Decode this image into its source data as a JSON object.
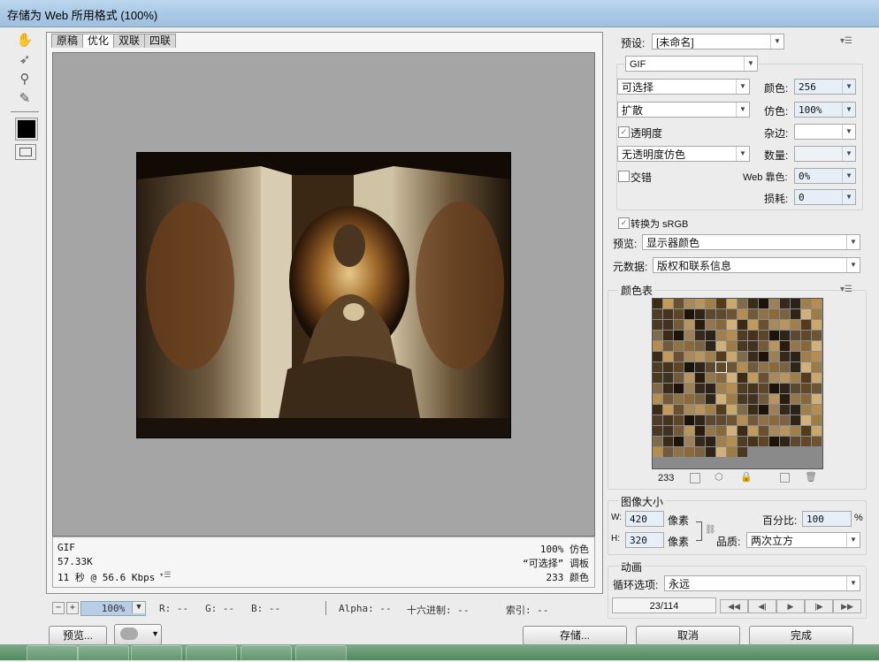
{
  "window": {
    "title": "存储为 Web 所用格式 (100%)"
  },
  "tabs": [
    "原稿",
    "优化",
    "双联",
    "四联"
  ],
  "info": {
    "left": [
      "GIF",
      "57.33K",
      "11 秒 @ 56.6 Kbps"
    ],
    "right": [
      "100% 仿色",
      "“可选择” 调板",
      "233 颜色"
    ]
  },
  "statusbar": {
    "zoom": "100%",
    "r": "R: --",
    "g": "G: --",
    "b": "B: --",
    "alpha": "Alpha: --",
    "hex": "十六进制: --",
    "index": "索引: --"
  },
  "buttons": {
    "preview": "预览...",
    "save": "存储...",
    "cancel": "取消",
    "done": "完成"
  },
  "settings": {
    "preset_label": "预设:",
    "preset_value": "[未命名]",
    "format": "GIF",
    "reduction": "可选择",
    "dither_algo": "扩散",
    "colors_label": "颜色:",
    "colors_value": "256",
    "dither_label": "仿色:",
    "dither_value": "100%",
    "transparency_label": "透明度",
    "transparency_checked": true,
    "matte_label": "杂边:",
    "trans_dither": "无透明度仿色",
    "amount_label": "数量:",
    "interlace_label": "交错",
    "interlace_checked": false,
    "websnap_label": "Web 靠色:",
    "websnap_value": "0%",
    "lossy_label": "损耗:",
    "lossy_value": "0",
    "srgb_label": "转换为 sRGB",
    "srgb_checked": true,
    "preview_label": "预览:",
    "preview_value": "显示器颜色",
    "metadata_label": "元数据:",
    "metadata_value": "版权和联系信息"
  },
  "color_table": {
    "title": "颜色表",
    "count": "233",
    "colors": [
      "#3b2a15",
      "#5e4525",
      "#8a6a3a",
      "#2a1c0c",
      "#a17f4b",
      "#6b5533",
      "#4a3820",
      "#c29a5a",
      "#1c130a",
      "#7b6240",
      "#93764b",
      "#533c1d",
      "#b58d4f",
      "#3f3222",
      "#685031",
      "#9a8157",
      "#2e2418",
      "#87683a",
      "#c9a86a",
      "#4f3c24",
      "#71593a",
      "#a88a5a",
      "#36281a",
      "#5a4830",
      "#d1b07a",
      "#7f6a4a",
      "#45331c",
      "#8d7346",
      "#b69561",
      "#2a2218",
      "#60492b",
      "#9c7b44"
    ]
  },
  "image_size": {
    "title": "图像大小",
    "w_label": "W:",
    "w_value": "420",
    "h_label": "H:",
    "h_value": "320",
    "unit": "像素",
    "percent_label": "百分比:",
    "percent_value": "100",
    "percent_unit": "%",
    "quality_label": "品质:",
    "quality_value": "两次立方"
  },
  "animation": {
    "title": "动画",
    "loop_label": "循环选项:",
    "loop_value": "永远",
    "frame": "23/114"
  }
}
